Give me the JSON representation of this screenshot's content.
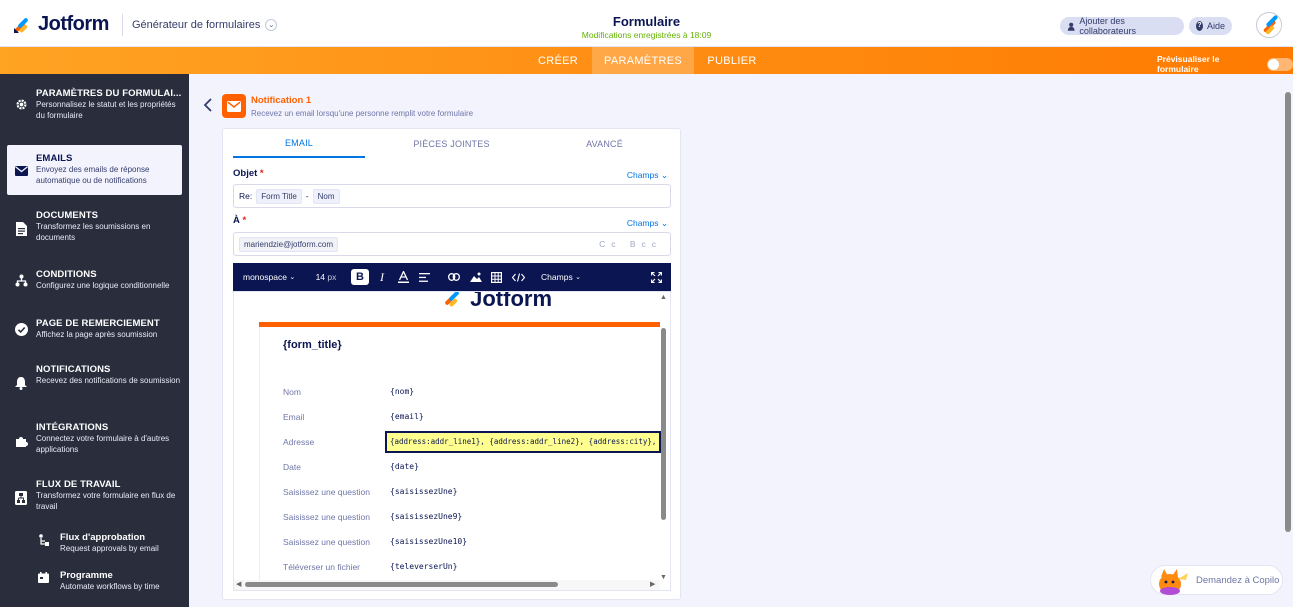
{
  "header": {
    "logo_text": "Jotform",
    "builder_label": "Générateur de formulaires",
    "form_title": "Formulaire",
    "save_status": "Modifications enregistrées à 18:09",
    "add_collaborators": "Ajouter des collaborateurs",
    "help": "Aide"
  },
  "nav": {
    "tabs": [
      {
        "label": "CRÉER"
      },
      {
        "label": "PARAMÈTRES"
      },
      {
        "label": "PUBLIER"
      }
    ],
    "preview_label": "Prévisualiser le formulaire"
  },
  "sidebar": {
    "items": [
      {
        "title": "PARAMÈTRES DU FORMULAI...",
        "desc": "Personnalisez le statut et les propriétés du formulaire",
        "icon": "gear-icon"
      },
      {
        "title": "EMAILS",
        "desc": "Envoyez des emails de réponse automatique ou de notifications",
        "icon": "envelope-icon"
      },
      {
        "title": "DOCUMENTS",
        "desc": "Transformez les soumissions en documents",
        "icon": "document-icon"
      },
      {
        "title": "CONDITIONS",
        "desc": "Configurez une logique conditionnelle",
        "icon": "conditions-icon"
      },
      {
        "title": "PAGE DE REMERCIEMENT",
        "desc": "Affichez la page après soumission",
        "icon": "check-icon"
      },
      {
        "title": "NOTIFICATIONS",
        "desc": "Recevez des notifications de soumission",
        "icon": "bell-icon"
      },
      {
        "title": "INTÉGRATIONS",
        "desc": "Connectez votre formulaire à d'autres applications",
        "icon": "puzzle-icon"
      },
      {
        "title": "FLUX DE TRAVAIL",
        "desc": "Transformez votre formulaire en flux de travail",
        "icon": "workflow-icon"
      }
    ],
    "subitems": [
      {
        "title": "Flux d'approbation",
        "desc": "Request approvals by email",
        "icon": "approval-flow-icon"
      },
      {
        "title": "Programme",
        "desc": "Automate workflows by time",
        "icon": "calendar-icon"
      }
    ]
  },
  "notification": {
    "title": "Notification 1",
    "subtitle": "Recevez un email lorsqu'une personne remplit votre formulaire"
  },
  "tabs": [
    {
      "label": "EMAIL"
    },
    {
      "label": "PIÈCES JOINTES"
    },
    {
      "label": "AVANCÉ"
    }
  ],
  "subject": {
    "label": "Objet",
    "required_mark": "*",
    "champs": "Champs",
    "prefix": "Re:",
    "chip1": "Form Title",
    "sep": "-",
    "chip2": "Nom"
  },
  "to": {
    "label": "À",
    "required_mark": "*",
    "champs": "Champs",
    "value": "mariendzie@jotform.com",
    "cc": "Cc",
    "bcc": "Bcc"
  },
  "toolbar": {
    "font": "monospace",
    "size": "14",
    "size_unit": "px",
    "champs": "Champs"
  },
  "editor": {
    "logo_text": "Jotform",
    "form_title": "{form_title}",
    "rows": [
      {
        "label": "Nom",
        "value": "{nom}"
      },
      {
        "label": "Email",
        "value": "{email}"
      },
      {
        "label": "Adresse",
        "value": "{address:addr_line1}, {address:addr_line2}, {address:city},"
      },
      {
        "label": "Date",
        "value": "{date}"
      },
      {
        "label": "Saisissez une question",
        "value": "{saisissezUne}"
      },
      {
        "label": "Saisissez une question",
        "value": "{saisissezUne9}"
      },
      {
        "label": "Saisissez une question",
        "value": "{saisissezUne10}"
      },
      {
        "label": "Téléverser un fichier",
        "value": "{televerserUn}"
      }
    ]
  },
  "copilot": {
    "label": "Demandez à Copilo"
  },
  "colors": {
    "orange": "#ff6100",
    "navy": "#0a1551",
    "blue": "#0075e3",
    "sidebar": "#292d3c",
    "green": "#64b200"
  }
}
